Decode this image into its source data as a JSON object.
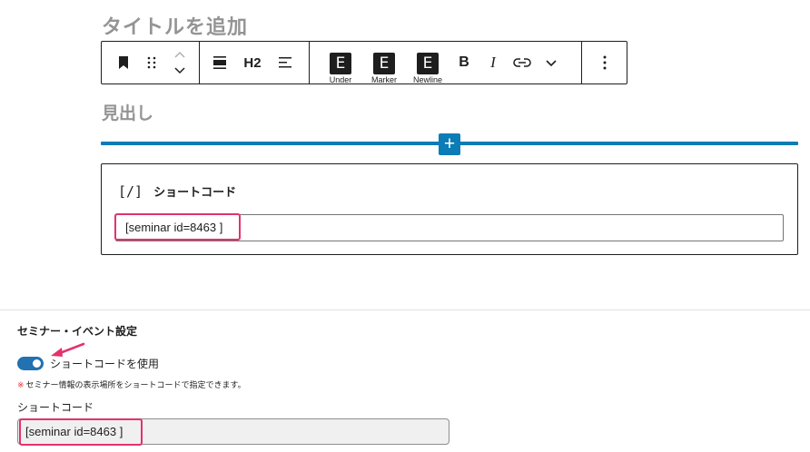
{
  "editor": {
    "title_placeholder": "タイトルを追加",
    "heading_placeholder": "見出し"
  },
  "toolbar": {
    "heading_level": "H2",
    "custom_buttons": [
      {
        "glyph": "E",
        "label": "Under"
      },
      {
        "glyph": "E",
        "label": "Marker"
      },
      {
        "glyph": "E",
        "label": "Newline"
      }
    ],
    "bold_glyph": "B",
    "italic_glyph": "I"
  },
  "inserter": {
    "glyph": "+"
  },
  "shortcode_block": {
    "icon": "[/]",
    "title": "ショートコード",
    "value": "[seminar id=8463 ]"
  },
  "panel": {
    "title": "セミナー・イベント設定",
    "toggle_label": "ショートコードを使用",
    "toggle_checked": true,
    "note_mark": "※",
    "note": "セミナー情報の表示場所をショートコードで指定できます。",
    "field_label": "ショートコード",
    "field_value": "[seminar id=8463 ]"
  },
  "colors": {
    "accent": "#0b7cb5",
    "highlight": "#e2336b",
    "toggle_on": "#2271b1",
    "placeholder_text": "#949494"
  }
}
